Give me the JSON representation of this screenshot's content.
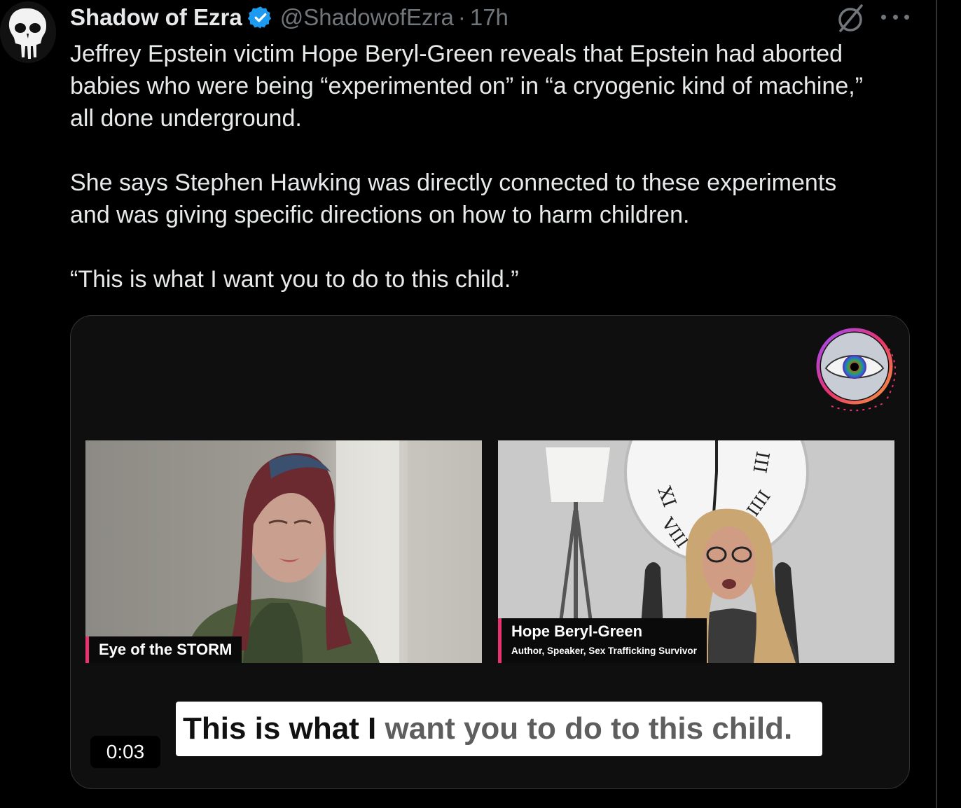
{
  "tweet": {
    "author": {
      "display_name": "Shadow of Ezra",
      "handle": "@ShadowofEzra",
      "verified": true,
      "avatar_icon": "skull-icon"
    },
    "time_separator": "·",
    "time": "17h",
    "paragraphs": [
      "Jeffrey Epstein victim Hope Beryl-Green reveals that Epstein had aborted\nbabies who were being “experimented on” in “a cryogenic kind of machine,”\nall done underground.",
      "She says Stephen Hawking was directly connected to these experiments\nand was giving specific directions on how to harm children.",
      "“This is what I want you to do to this child.”"
    ],
    "actions": {
      "grok_icon": "grok-icon",
      "more_icon": "more-icon"
    }
  },
  "video": {
    "logo_text": "eye of the storm",
    "left_panel": {
      "lower_third": "Eye of the STORM"
    },
    "right_panel": {
      "name": "Hope Beryl-Green",
      "subtitle": "Author, Speaker, Sex Trafficking Survivor"
    },
    "caption_active": "This is what I",
    "caption_rest": " want you to do to this child.",
    "timestamp": "0:03"
  },
  "colors": {
    "background": "#000000",
    "text": "#e7e9ea",
    "muted": "#71767b",
    "verified": "#1d9bf0",
    "lower_third_accent": "#e8336e"
  }
}
